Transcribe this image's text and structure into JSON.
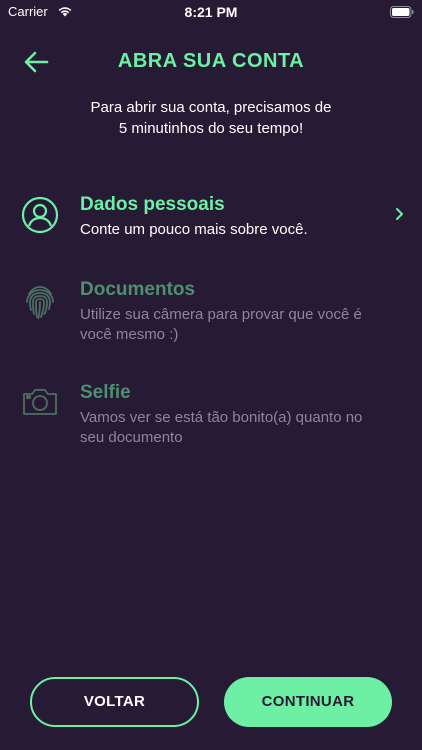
{
  "status_bar": {
    "carrier": "Carrier",
    "time": "8:21 PM",
    "wifi_icon": "wifi-icon",
    "battery_icon": "battery-icon"
  },
  "header": {
    "title": "ABRA SUA CONTA",
    "back_icon": "arrow-left-icon"
  },
  "intro": {
    "line1": "Para abrir sua conta, precisamos de",
    "line2": "5 minutinhos do seu tempo!"
  },
  "steps": [
    {
      "title": "Dados pessoais",
      "description": "Conte um pouco mais sobre você.",
      "icon": "user-icon",
      "state": "active"
    },
    {
      "title": "Documentos",
      "description": "Utilize sua câmera para provar que você é você mesmo :)",
      "icon": "fingerprint-icon",
      "state": "inactive"
    },
    {
      "title": "Selfie",
      "description": "Vamos ver se está tão bonito(a) quanto no seu documento",
      "icon": "camera-icon",
      "state": "inactive"
    }
  ],
  "buttons": {
    "back_label": "VOLTAR",
    "continue_label": "CONTINUAR"
  },
  "colors": {
    "background": "#261a34",
    "accent": "#6df0a4",
    "inactive_title": "#4d8f6f",
    "inactive_text": "#8d8797"
  }
}
